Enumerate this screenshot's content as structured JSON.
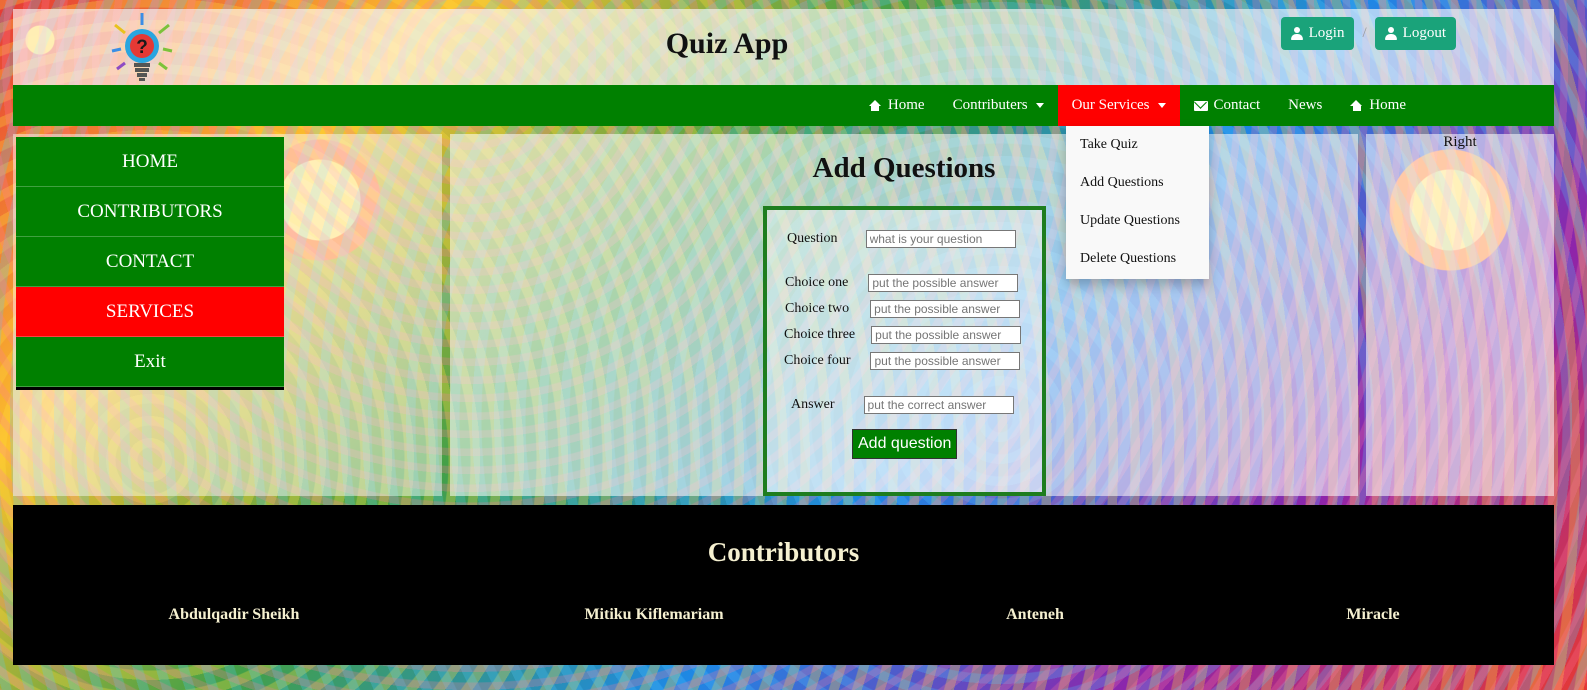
{
  "header": {
    "title": "Quiz App",
    "logo_icon": "lightbulb-question-icon",
    "login_label": "Login",
    "logout_label": "Logout",
    "separator": "/"
  },
  "navbar": {
    "items": [
      {
        "label": "Home",
        "icon": "home-icon"
      },
      {
        "label": "Contributers",
        "icon": "caret-down-icon"
      },
      {
        "label": "Our Services",
        "icon": "caret-down-icon",
        "active": true
      },
      {
        "label": "Contact",
        "icon": "envelope-icon"
      },
      {
        "label": "News"
      },
      {
        "label": "Home",
        "icon": "home-icon"
      }
    ],
    "dropdown": [
      "Take Quiz",
      "Add Questions",
      "Update Questions",
      "Delete Questions"
    ]
  },
  "sidebar": {
    "items": [
      {
        "label": "HOME"
      },
      {
        "label": "CONTRIBUTORS"
      },
      {
        "label": "CONTACT"
      },
      {
        "label": "SERVICES",
        "active": true
      },
      {
        "label": "Exit"
      }
    ]
  },
  "main": {
    "title": "Add Questions",
    "form": {
      "question_label": "Question",
      "question_placeholder": "what is your question",
      "choice1_label": "Choice one",
      "choice2_label": "Choice two",
      "choice3_label": "Choice three",
      "choice4_label": "Choice four",
      "choice_placeholder": "put the possible answer",
      "answer_label": "Answer",
      "answer_placeholder": "put the correct answer",
      "submit_label": "Add question"
    }
  },
  "right_panel": {
    "label": "Right"
  },
  "footer": {
    "title": "Contributors",
    "names": [
      "Abdulqadir Sheikh",
      "Mitiku Kiflemariam",
      "Anteneh",
      "Miracle"
    ]
  },
  "colors": {
    "nav_green": "#008000",
    "active_red": "#ff0000",
    "auth_button": "#1aa37a",
    "footer_bg": "#000000",
    "footer_text": "#f5f0d0"
  }
}
